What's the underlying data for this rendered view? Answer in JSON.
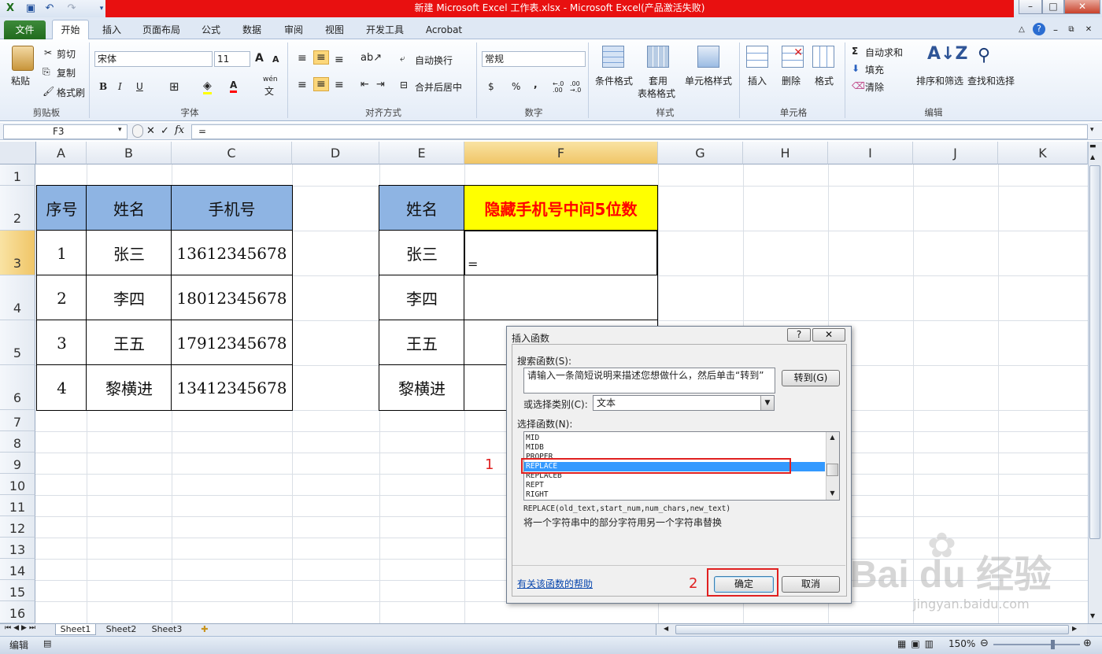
{
  "window": {
    "title": "新建 Microsoft Excel 工作表.xlsx  -  Microsoft Excel(产品激活失败)"
  },
  "tabs": {
    "file": "文件",
    "items": [
      "开始",
      "插入",
      "页面布局",
      "公式",
      "数据",
      "审阅",
      "视图",
      "开发工具",
      "Acrobat"
    ]
  },
  "ribbon": {
    "clipboard": {
      "paste": "粘贴",
      "cut": "剪切",
      "copy": "复制",
      "format_painter": "格式刷",
      "label": "剪贴板"
    },
    "font": {
      "name": "宋体",
      "size": "11",
      "label": "字体",
      "bold": "B",
      "italic": "I",
      "underline": "U",
      "font_color_letter": "A",
      "grow": "A",
      "shrink": "A",
      "phonetic_top": "wén",
      "phonetic_bottom": "文"
    },
    "alignment": {
      "wrap": "自动换行",
      "merge": "合并后居中",
      "label": "对齐方式"
    },
    "number": {
      "format": "常规",
      "currency": "$",
      "percent": "%",
      "comma": ",",
      "inc_decimal": "←.0 .00",
      "dec_decimal": ".00 →.0",
      "label": "数字"
    },
    "styles": {
      "conditional": "条件格式",
      "table_fmt_1": "套用",
      "table_fmt_2": "表格格式",
      "cell_styles": "单元格样式",
      "label": "样式"
    },
    "cells": {
      "insert": "插入",
      "delete": "删除",
      "format": "格式",
      "label": "单元格"
    },
    "editing": {
      "autosum": "自动求和",
      "fill": "填充",
      "clear": "清除",
      "sort": "排序和筛选",
      "find": "查找和选择",
      "label": "编辑"
    }
  },
  "formula_bar": {
    "name_box": "F3",
    "formula": "="
  },
  "columns": [
    "A",
    "B",
    "C",
    "D",
    "E",
    "F",
    "G",
    "H",
    "I",
    "J",
    "K"
  ],
  "rows": [
    "1",
    "2",
    "3",
    "4",
    "5",
    "6",
    "7",
    "8",
    "9",
    "10",
    "11",
    "12",
    "13",
    "14",
    "15",
    "16"
  ],
  "table1": {
    "headers": [
      "序号",
      "姓名",
      "手机号"
    ],
    "rows": [
      [
        "1",
        "张三",
        "13612345678"
      ],
      [
        "2",
        "李四",
        "18012345678"
      ],
      [
        "3",
        "王五",
        "17912345678"
      ],
      [
        "4",
        "黎横进",
        "13412345678"
      ]
    ]
  },
  "table2": {
    "headers": [
      "姓名",
      "隐藏手机号中间5位数"
    ],
    "names": [
      "张三",
      "李四",
      "王五",
      "黎横进"
    ],
    "f3_value": "="
  },
  "dialog": {
    "title": "插入函数",
    "help_btn": "?",
    "close_btn": "✕",
    "search_label": "搜索函数(S):",
    "search_placeholder": "请输入一条简短说明来描述您想做什么，然后单击“转到”",
    "go_button": "转到(G)",
    "category_label": "或选择类别(C):",
    "category_value": "文本",
    "select_label": "选择函数(N):",
    "functions": [
      "MID",
      "MIDB",
      "PROPER",
      "REPLACE",
      "REPLACEB",
      "REPT",
      "RIGHT"
    ],
    "selected_function": "REPLACE",
    "signature": "REPLACE(old_text,start_num,num_chars,new_text)",
    "description": "将一个字符串中的部分字符用另一个字符串替换",
    "help_link": "有关该函数的帮助",
    "ok": "确定",
    "cancel": "取消"
  },
  "annotations": {
    "step1": "1",
    "step2": "2",
    "color": "#e02020"
  },
  "sheets": [
    "Sheet1",
    "Sheet2",
    "Sheet3"
  ],
  "status": {
    "mode": "编辑",
    "zoom": "150%"
  },
  "watermark": {
    "brand": "Bai du 经验",
    "url": "jingyan.baidu.com"
  },
  "colors": {
    "header_blue": "#8eb4e3",
    "header_yellow": "#ffff00",
    "red_text": "#ff0000",
    "selection": "#3399ff"
  }
}
